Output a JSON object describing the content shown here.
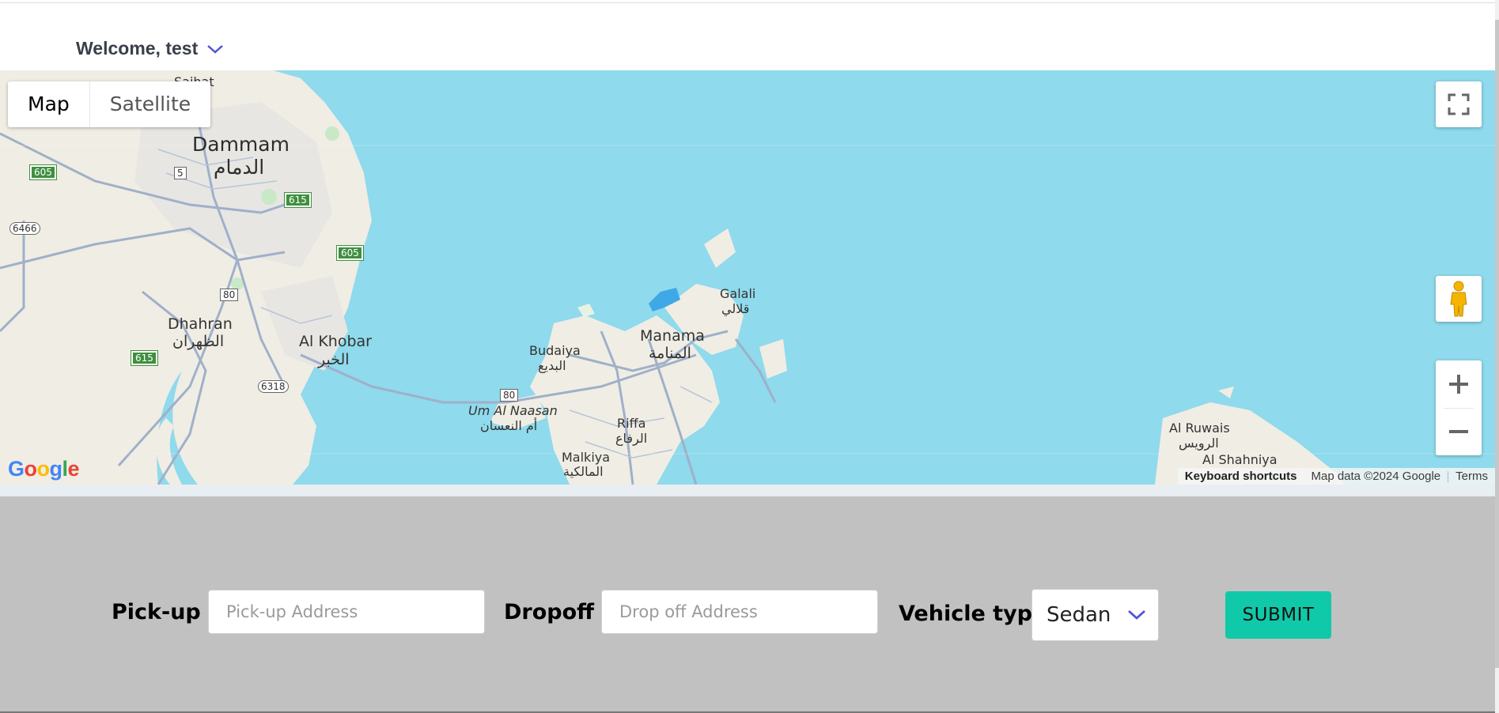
{
  "header": {
    "welcome_text": "Welcome, test",
    "chevron_icon": "chevron-down-icon",
    "accent_color": "#4f54d6"
  },
  "map": {
    "type_buttons": {
      "map": "Map",
      "satellite": "Satellite"
    },
    "controls": {
      "fullscreen_icon": "fullscreen-icon",
      "pegman_icon": "pegman-icon",
      "zoom_in_icon": "plus-icon",
      "zoom_out_icon": "minus-icon"
    },
    "logo": "Google",
    "attribution": {
      "keyboard_shortcuts": "Keyboard shortcuts",
      "map_data": "Map data ©2024 Google",
      "terms": "Terms"
    },
    "water_color": "#8fdaec",
    "land_color": "#f0ede4",
    "places": {
      "saihat": "Saihat",
      "dammam": "Dammam",
      "dammam_ar": "الدمام",
      "dhahran": "Dhahran",
      "dhahran_ar": "الظهران",
      "al_khobar": "Al Khobar",
      "al_khobar_ar": "الخبر",
      "budaiya": "Budaiya",
      "budaiya_ar": "البديع",
      "manama": "Manama",
      "manama_ar": "المنامة",
      "galali": "Galali",
      "galali_ar": "قلالي",
      "um_al_naasan": "Um Al Naasan",
      "um_al_naasan_ar": "أم النعسان",
      "riffa": "Riffa",
      "riffa_ar": "الرفاع",
      "malkiya": "Malkiya",
      "malkiya_ar": "المالكية",
      "al_ruwais": "Al Ruwais",
      "al_ruwais_ar": "الرويس",
      "al_shahniya": "Al Shahniya"
    },
    "road_shields": {
      "r605a": "605",
      "r5": "5",
      "r615a": "615",
      "r6466": "6466",
      "r605b": "605",
      "r80a": "80",
      "r615b": "615",
      "r6318": "6318",
      "r80b": "80"
    }
  },
  "form": {
    "pickup_label": "Pick-up",
    "pickup_placeholder": "Pick-up Address",
    "pickup_value": "",
    "dropoff_label": "Dropoff",
    "dropoff_placeholder": "Drop off Address",
    "dropoff_value": "",
    "vehicle_label": "Vehicle type",
    "vehicle_selected": "Sedan",
    "submit_label": "SUBMIT",
    "submit_color": "#10c9a8",
    "background_color": "#c1c1c1"
  }
}
